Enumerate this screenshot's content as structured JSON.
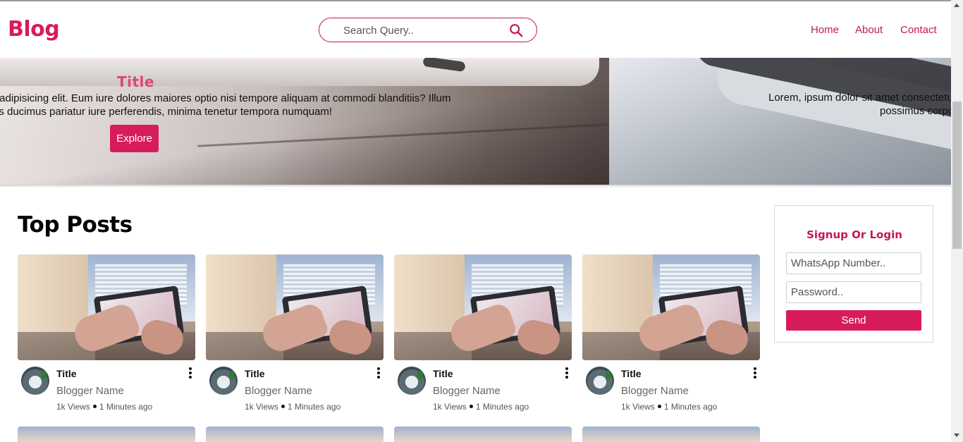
{
  "header": {
    "logo": "Blog",
    "search_placeholder": "Search Query..",
    "nav": {
      "home": "Home",
      "about": "About",
      "contact": "Contact"
    }
  },
  "hero": {
    "title": "Title",
    "text_line1": "r adipisicing elit. Eum iure dolores maiores optio nisi tempore aliquam at commodi blanditiis? Illum",
    "text_line2": "ris ducimus pariatur iure perferendis, minima tenetur tempora numquam!",
    "explore_label": "Explore",
    "next_text_line1": "Lorem, ipsum dolor sit amet consectetur",
    "next_text_line2": "possimus corpo"
  },
  "main": {
    "section_title": "Top Posts",
    "posts": [
      {
        "title": "Title",
        "author": "Blogger Name",
        "views": "1k Views",
        "time": "1 Minutes ago"
      },
      {
        "title": "Title",
        "author": "Blogger Name",
        "views": "1k Views",
        "time": "1 Minutes ago"
      },
      {
        "title": "Title",
        "author": "Blogger Name",
        "views": "1k Views",
        "time": "1 Minutes ago"
      },
      {
        "title": "Title",
        "author": "Blogger Name",
        "views": "1k Views",
        "time": "1 Minutes ago"
      }
    ]
  },
  "signup": {
    "heading": "Signup Or Login",
    "whatsapp_placeholder": "WhatsApp Number..",
    "password_placeholder": "Password..",
    "send_label": "Send"
  },
  "colors": {
    "accent": "#d81b5b",
    "nav": "#c2185b"
  },
  "icons": {
    "search": "search-icon",
    "more": "more-vertical-icon"
  }
}
